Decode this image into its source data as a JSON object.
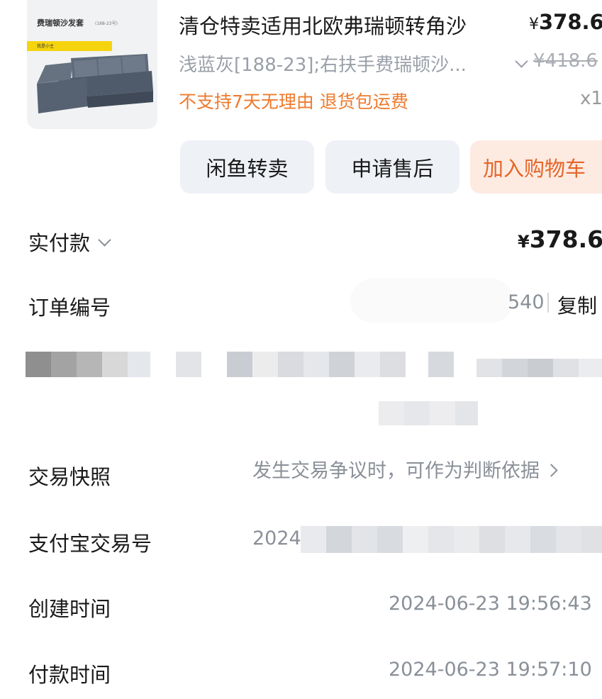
{
  "product": {
    "thumb_title": "费瑞顿沙发套",
    "thumb_code": "(188-23号)",
    "thumb_band": "我是小主",
    "title": "清仓特卖适用北欧弗瑞顿转角沙",
    "price_symbol": "¥",
    "price": "378.6",
    "variant": "浅蓝灰[188-23];右扶手费瑞顿沙...",
    "original_price": "¥418.6",
    "policy": "不支持7天无理由  退货包运费",
    "quantity": "x1"
  },
  "actions": {
    "resell": "闲鱼转卖",
    "after_sales": "申请售后",
    "add_to_cart": "加入购物车"
  },
  "order": {
    "paid_label": "实付款",
    "paid_symbol": "¥",
    "paid_value": "378.6",
    "order_no_label": "订单编号",
    "order_no_tail": "540",
    "copy": "复制",
    "snapshot_label": "交易快照",
    "snapshot_value": "发生交易争议时，可作为判断依据",
    "alipay_label": "支付宝交易号",
    "alipay_prefix": "2024",
    "created_label": "创建时间",
    "created_value": "2024-06-23 19:56:43",
    "paid_time_label": "付款时间",
    "paid_time_value": "2024-06-23 19:57:10"
  },
  "colors": {
    "accent_orange": "#ee7a2d",
    "cart_bg": "#fdebe2",
    "button_bg": "#eef1f5",
    "muted_text": "#8a9098"
  },
  "icons": [
    "chevron-down-icon",
    "chevron-right-icon"
  ]
}
